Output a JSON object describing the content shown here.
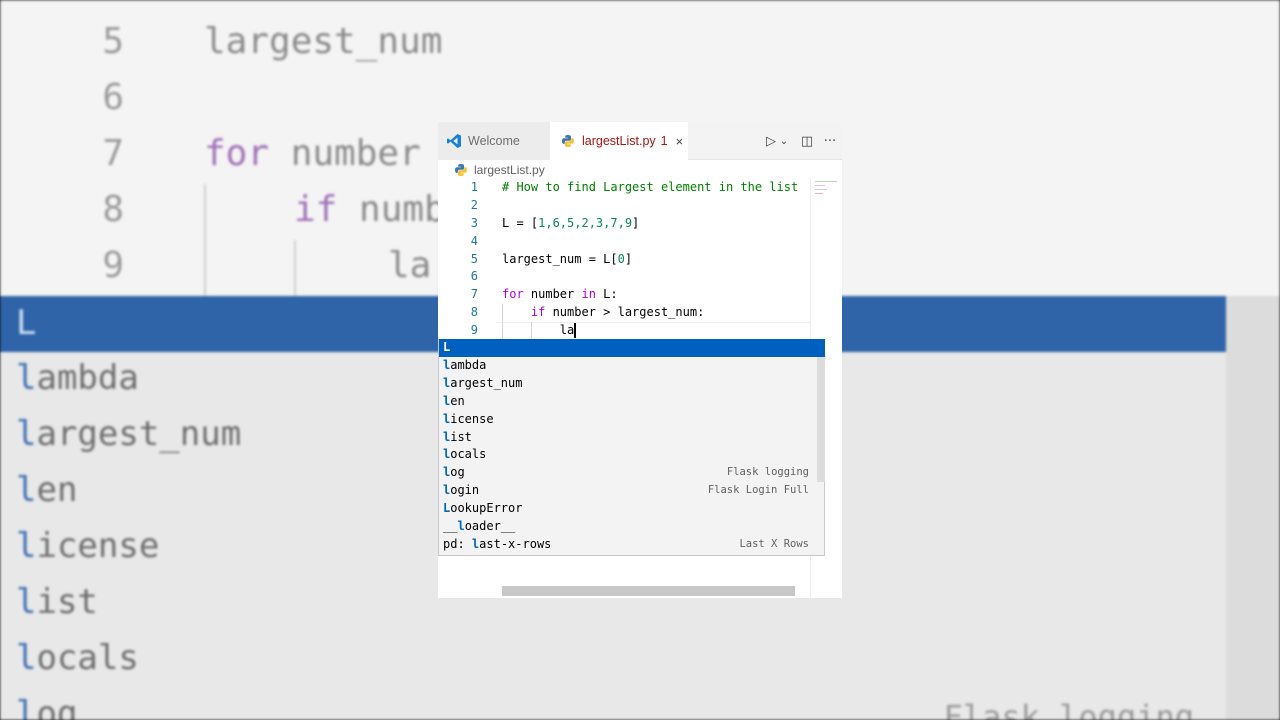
{
  "background": {
    "lines": [
      {
        "num": "5",
        "code": "largest_num"
      },
      {
        "num": "6",
        "code": ""
      },
      {
        "num": "7",
        "kw": "for",
        "code": " number"
      },
      {
        "num": "8",
        "kw": "if",
        "code": " numb"
      },
      {
        "num": "9",
        "code": "la"
      }
    ],
    "highlight_item": "L",
    "items": [
      "ambda",
      "argest_num",
      "en",
      "icense",
      "ist",
      "ocals",
      "og"
    ],
    "right_note": "Flask logging"
  },
  "tabs": {
    "welcome_label": "Welcome",
    "file_label": "largestList.py",
    "file_problems": "1",
    "close_glyph": "×"
  },
  "toolbar": {
    "run_glyph": "▷",
    "run_dropdown_glyph": "⌄",
    "split_glyph": "◫",
    "more_glyph": "···"
  },
  "breadcrumb": {
    "file": "largestList.py"
  },
  "code": {
    "lines": [
      {
        "num": "1",
        "comment": "# How to find Largest element in the list"
      },
      {
        "num": "2"
      },
      {
        "num": "3",
        "pre": "L = [",
        "nums": "1,6,5,2,3,7,9",
        "post": "]"
      },
      {
        "num": "4"
      },
      {
        "num": "5",
        "pre": "largest_num = L[",
        "nums": "0",
        "post": "]"
      },
      {
        "num": "6"
      },
      {
        "num": "7",
        "kw": "for",
        "rest": " number ",
        "kw2": "in",
        "rest2": " L:"
      },
      {
        "num": "8",
        "indent": "    ",
        "kw": "if",
        "rest": " number > largest_num:"
      },
      {
        "num": "9",
        "indent": "        ",
        "rest": "la"
      }
    ]
  },
  "suggestions": [
    {
      "match": "L",
      "rest": "",
      "detail": "",
      "selected": true
    },
    {
      "match": "l",
      "rest": "ambda",
      "detail": ""
    },
    {
      "match": "l",
      "rest": "argest_num",
      "detail": ""
    },
    {
      "match": "l",
      "rest": "en",
      "detail": ""
    },
    {
      "match": "l",
      "rest": "icense",
      "detail": ""
    },
    {
      "match": "l",
      "rest": "ist",
      "detail": ""
    },
    {
      "match": "l",
      "rest": "ocals",
      "detail": ""
    },
    {
      "match": "l",
      "rest": "og",
      "detail": "Flask logging"
    },
    {
      "match": "l",
      "rest": "ogin",
      "detail": "Flask Login Full"
    },
    {
      "match": "L",
      "rest": "ookupError",
      "detail": ""
    },
    {
      "pre": "__",
      "match": "l",
      "rest": "oader__",
      "detail": ""
    },
    {
      "pre": "pd: ",
      "match": "l",
      "rest": "ast-x-rows",
      "detail": "Last X Rows"
    }
  ],
  "colors": {
    "accent": "#0060c0",
    "tab_active_text": "#a31515",
    "comment": "#008000",
    "keyword": "#af00db",
    "number": "#098658"
  }
}
